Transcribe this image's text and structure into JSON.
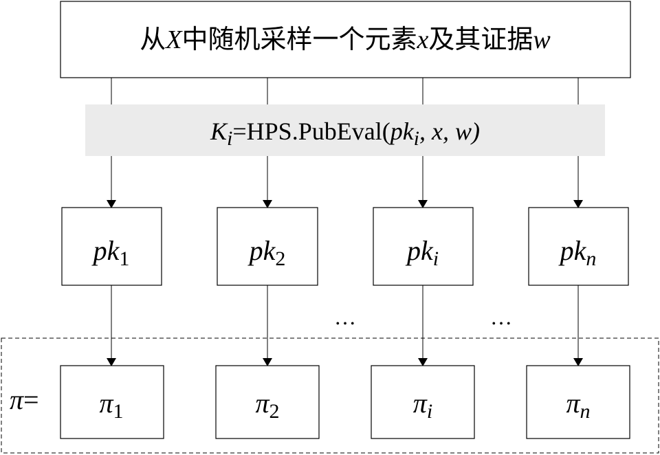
{
  "top_box": {
    "parts": [
      {
        "text": "从",
        "italic": false
      },
      {
        "text": "X",
        "italic": true
      },
      {
        "text": "中随机采样一个元素",
        "italic": false
      },
      {
        "text": "x",
        "italic": true
      },
      {
        "text": "及其证据",
        "italic": false
      },
      {
        "text": "w",
        "italic": true
      }
    ]
  },
  "formula": {
    "k": "K",
    "k_sub": "i",
    "eq_fn": "=HPS.PubEval(",
    "pk": "pk",
    "pk_sub": "i",
    "rest": ", x, w)"
  },
  "pk_nodes": [
    {
      "base": "pk",
      "sub": "1"
    },
    {
      "base": "pk",
      "sub": "2"
    },
    {
      "base": "pk",
      "sub": "i"
    },
    {
      "base": "pk",
      "sub": "n"
    }
  ],
  "pi_nodes": [
    {
      "base": "π",
      "sub": "1"
    },
    {
      "base": "π",
      "sub": "2"
    },
    {
      "base": "π",
      "sub": "i"
    },
    {
      "base": "π",
      "sub": "n"
    }
  ],
  "ellipses": [
    "…",
    "…"
  ],
  "pi_label": {
    "symbol": "π",
    "eq": "="
  },
  "colors": {
    "formula_band": "#ebebeb",
    "line": "#000000",
    "box_fill": "#ffffff"
  }
}
